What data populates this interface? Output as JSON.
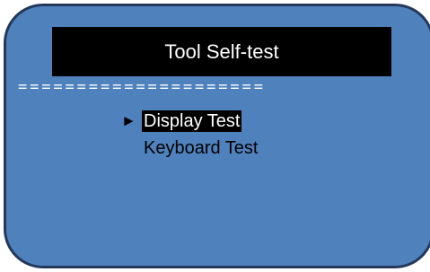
{
  "screen": {
    "title": "Tool Self-test",
    "divider": "=====================",
    "selected_marker": "►"
  },
  "menu": {
    "items": [
      {
        "label": "Display Test",
        "selected": true
      },
      {
        "label": "Keyboard Test",
        "selected": false
      }
    ]
  },
  "colors": {
    "screen_background": "#4f81bd",
    "screen_border": "#24395a",
    "title_background": "#000000",
    "highlight_background": "#000000",
    "highlight_text": "#ffffff",
    "text": "#000000"
  }
}
